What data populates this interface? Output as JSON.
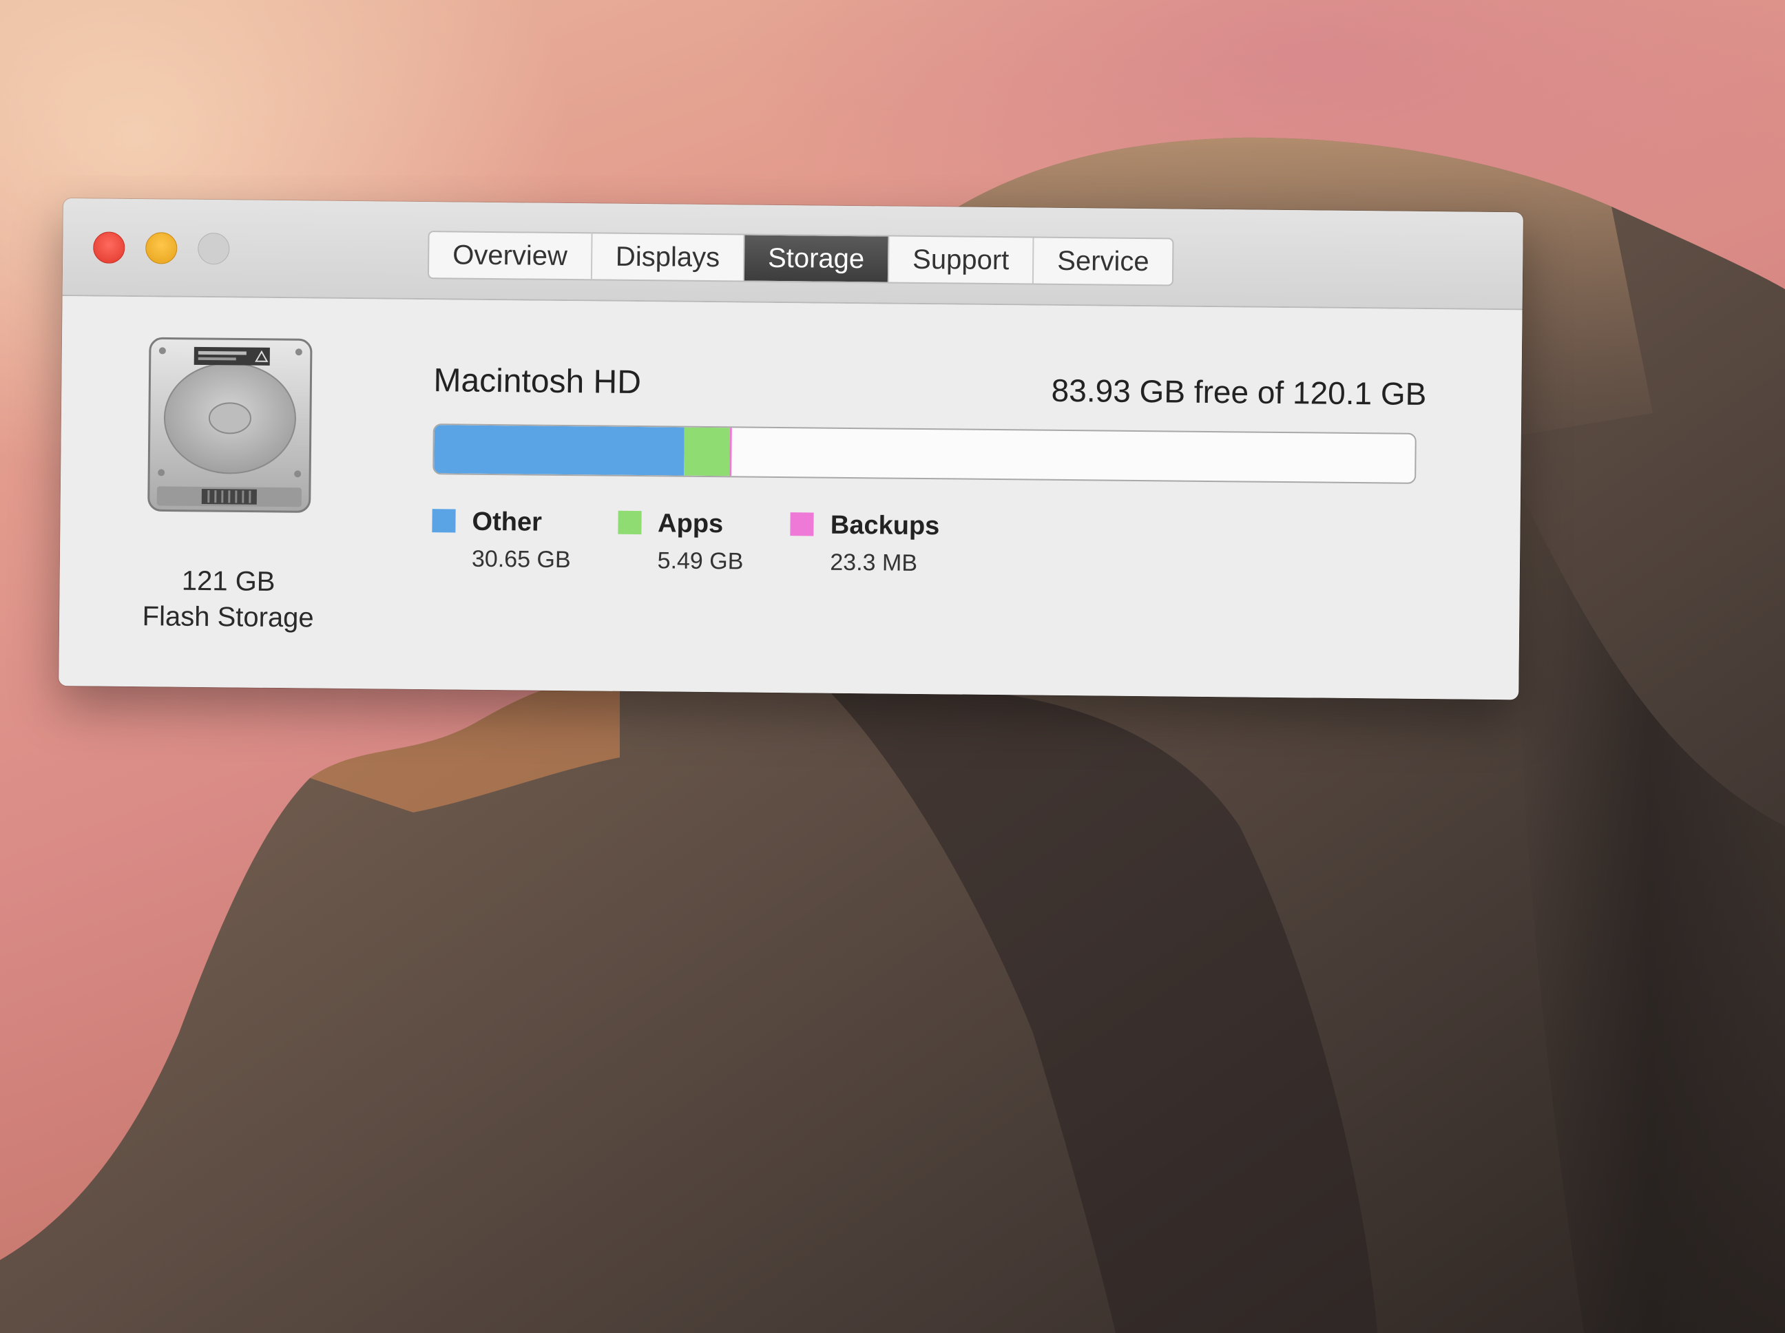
{
  "window": {
    "tabs": [
      {
        "label": "Overview",
        "active": false
      },
      {
        "label": "Displays",
        "active": false
      },
      {
        "label": "Storage",
        "active": true
      },
      {
        "label": "Support",
        "active": false
      },
      {
        "label": "Service",
        "active": false
      }
    ]
  },
  "disk": {
    "capacity": "121 GB",
    "type": "Flash Storage",
    "icon": "hard-drive-icon"
  },
  "volume": {
    "name": "Macintosh HD",
    "free_summary": "83.93 GB free of 120.1 GB",
    "total_gb": 120.1,
    "free_gb": 83.93
  },
  "usage": [
    {
      "name": "Other",
      "size": "30.65 GB",
      "gb": 30.65,
      "color": "#5aa4e6"
    },
    {
      "name": "Apps",
      "size": "5.49 GB",
      "gb": 5.49,
      "color": "#8fdc72"
    },
    {
      "name": "Backups",
      "size": "23.3 MB",
      "gb": 0.0233,
      "color": "#ef79d6"
    }
  ],
  "colors": {
    "close": "#ff5f57",
    "minimize": "#ffbd2e",
    "zoom": "#cfcfcf",
    "active_tab": "#474747"
  }
}
